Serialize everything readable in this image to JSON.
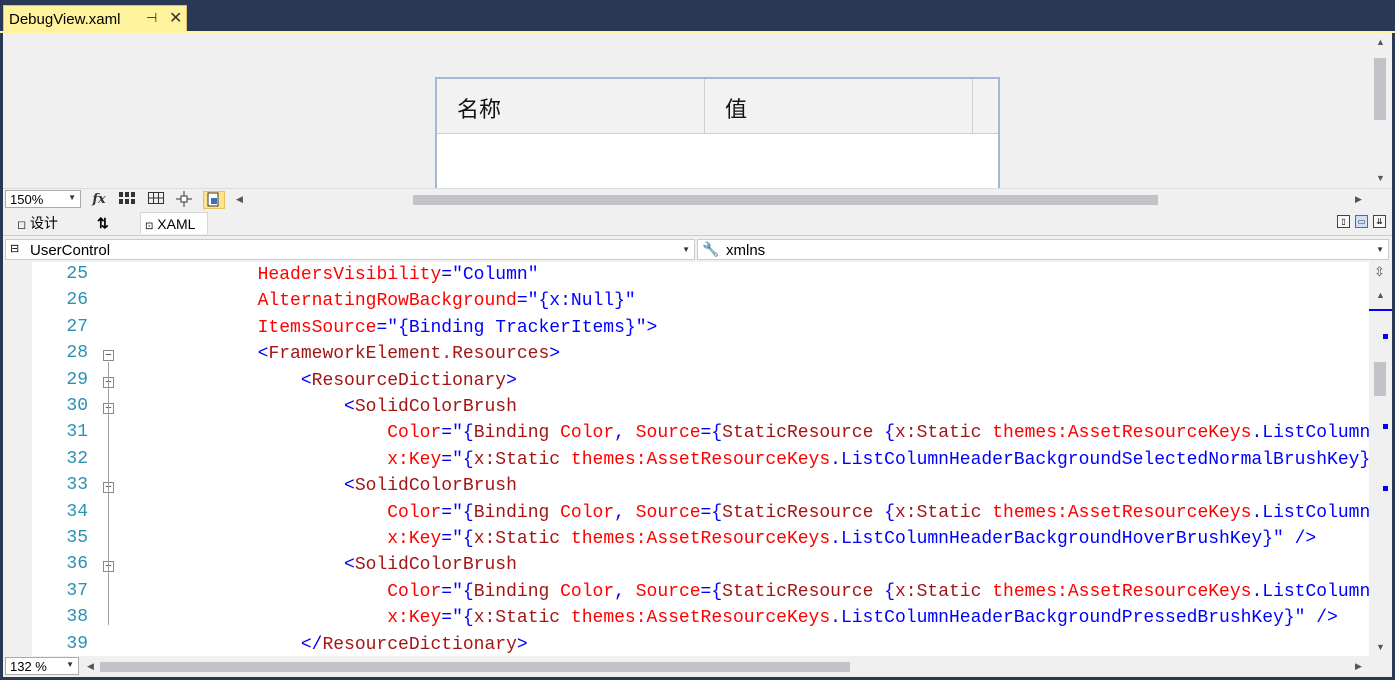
{
  "document_tab": {
    "title": "DebugView.xaml",
    "pin_glyph": "⊣",
    "close_glyph": "✕"
  },
  "designer": {
    "datagrid_columns": [
      "名称",
      "值"
    ],
    "zoom": "150%",
    "toolbar_icons": [
      "fx-icon",
      "grid-icon",
      "snap-grid-icon",
      "snap-lines-icon",
      "render-effects-icon"
    ]
  },
  "split_tabs": {
    "design_label": "设计",
    "swap_glyph": "⇅",
    "xaml_label": "XAML"
  },
  "navbar": {
    "left_value": "UserControl",
    "right_value": "xmlns"
  },
  "editor": {
    "zoom": "132 %",
    "lines": [
      {
        "n": "25",
        "fold": false,
        "segments": [
          {
            "c": "a",
            "t": "            HeadersVisibility"
          },
          {
            "c": "q",
            "t": "=\""
          },
          {
            "c": "s",
            "t": "Column"
          },
          {
            "c": "q",
            "t": "\""
          }
        ]
      },
      {
        "n": "26",
        "fold": false,
        "segments": [
          {
            "c": "a",
            "t": "            AlternatingRowBackground"
          },
          {
            "c": "q",
            "t": "=\""
          },
          {
            "c": "s",
            "t": "{x:Null}"
          },
          {
            "c": "q",
            "t": "\""
          }
        ]
      },
      {
        "n": "27",
        "fold": false,
        "segments": [
          {
            "c": "a",
            "t": "            ItemsSource"
          },
          {
            "c": "q",
            "t": "=\""
          },
          {
            "c": "s",
            "t": "{Binding TrackerItems}"
          },
          {
            "c": "q",
            "t": "\""
          },
          {
            "c": "q",
            "t": ">"
          }
        ]
      },
      {
        "n": "28",
        "fold": true,
        "segments": [
          {
            "c": "q",
            "t": "            <"
          },
          {
            "c": "t",
            "t": "FrameworkElement.Resources"
          },
          {
            "c": "q",
            "t": ">"
          }
        ]
      },
      {
        "n": "29",
        "fold": true,
        "segments": [
          {
            "c": "q",
            "t": "                <"
          },
          {
            "c": "t",
            "t": "ResourceDictionary"
          },
          {
            "c": "q",
            "t": ">"
          }
        ]
      },
      {
        "n": "30",
        "fold": true,
        "segments": [
          {
            "c": "q",
            "t": "                    <"
          },
          {
            "c": "t",
            "t": "SolidColorBrush"
          }
        ]
      },
      {
        "n": "31",
        "fold": false,
        "segments": [
          {
            "c": "a",
            "t": "                        Color"
          },
          {
            "c": "q",
            "t": "=\""
          },
          {
            "c": "s",
            "t": "{"
          },
          {
            "c": "t",
            "t": "Binding"
          },
          {
            "c": "a",
            "t": " Color"
          },
          {
            "c": "s",
            "t": ", "
          },
          {
            "c": "a",
            "t": "Source"
          },
          {
            "c": "s",
            "t": "={"
          },
          {
            "c": "t",
            "t": "StaticResource"
          },
          {
            "c": "s",
            "t": " {"
          },
          {
            "c": "t",
            "t": "x:Static"
          },
          {
            "c": "a",
            "t": " themes:AssetResourceKeys"
          },
          {
            "c": "s",
            "t": ".ListColumnHeaderBackgroundSelectedNormalBrushKey}}}"
          }
        ]
      },
      {
        "n": "32",
        "fold": false,
        "segments": [
          {
            "c": "a",
            "t": "                        x:Key"
          },
          {
            "c": "q",
            "t": "=\""
          },
          {
            "c": "s",
            "t": "{"
          },
          {
            "c": "t",
            "t": "x:Static"
          },
          {
            "c": "a",
            "t": " themes:AssetResourceKeys"
          },
          {
            "c": "s",
            "t": ".ListColumnHeaderBackgroundSelectedNormalBrushKey}"
          },
          {
            "c": "q",
            "t": "\" />"
          }
        ]
      },
      {
        "n": "33",
        "fold": true,
        "segments": [
          {
            "c": "q",
            "t": "                    <"
          },
          {
            "c": "t",
            "t": "SolidColorBrush"
          }
        ]
      },
      {
        "n": "34",
        "fold": false,
        "segments": [
          {
            "c": "a",
            "t": "                        Color"
          },
          {
            "c": "q",
            "t": "=\""
          },
          {
            "c": "s",
            "t": "{"
          },
          {
            "c": "t",
            "t": "Binding"
          },
          {
            "c": "a",
            "t": " Color"
          },
          {
            "c": "s",
            "t": ", "
          },
          {
            "c": "a",
            "t": "Source"
          },
          {
            "c": "s",
            "t": "={"
          },
          {
            "c": "t",
            "t": "StaticResource"
          },
          {
            "c": "s",
            "t": " {"
          },
          {
            "c": "t",
            "t": "x:Static"
          },
          {
            "c": "a",
            "t": " themes:AssetResourceKeys"
          },
          {
            "c": "s",
            "t": ".ListColumnHeaderBackgroundHoverBrushKey}}}"
          }
        ]
      },
      {
        "n": "35",
        "fold": false,
        "segments": [
          {
            "c": "a",
            "t": "                        x:Key"
          },
          {
            "c": "q",
            "t": "=\""
          },
          {
            "c": "s",
            "t": "{"
          },
          {
            "c": "t",
            "t": "x:Static"
          },
          {
            "c": "a",
            "t": " themes:AssetResourceKeys"
          },
          {
            "c": "s",
            "t": ".ListColumnHeaderBackgroundHoverBrushKey}"
          },
          {
            "c": "q",
            "t": "\" />"
          }
        ]
      },
      {
        "n": "36",
        "fold": true,
        "segments": [
          {
            "c": "q",
            "t": "                    <"
          },
          {
            "c": "t",
            "t": "SolidColorBrush"
          }
        ]
      },
      {
        "n": "37",
        "fold": false,
        "segments": [
          {
            "c": "a",
            "t": "                        Color"
          },
          {
            "c": "q",
            "t": "=\""
          },
          {
            "c": "s",
            "t": "{"
          },
          {
            "c": "t",
            "t": "Binding"
          },
          {
            "c": "a",
            "t": " Color"
          },
          {
            "c": "s",
            "t": ", "
          },
          {
            "c": "a",
            "t": "Source"
          },
          {
            "c": "s",
            "t": "={"
          },
          {
            "c": "t",
            "t": "StaticResource"
          },
          {
            "c": "s",
            "t": " {"
          },
          {
            "c": "t",
            "t": "x:Static"
          },
          {
            "c": "a",
            "t": " themes:AssetResourceKeys"
          },
          {
            "c": "s",
            "t": ".ListColumnHeaderBackgroundPressedBrushKey}}}"
          }
        ]
      },
      {
        "n": "38",
        "fold": false,
        "segments": [
          {
            "c": "a",
            "t": "                        x:Key"
          },
          {
            "c": "q",
            "t": "=\""
          },
          {
            "c": "s",
            "t": "{"
          },
          {
            "c": "t",
            "t": "x:Static"
          },
          {
            "c": "a",
            "t": " themes:AssetResourceKeys"
          },
          {
            "c": "s",
            "t": ".ListColumnHeaderBackgroundPressedBrushKey}"
          },
          {
            "c": "q",
            "t": "\" />"
          }
        ]
      },
      {
        "n": "39",
        "fold": false,
        "segments": [
          {
            "c": "q",
            "t": "                </"
          },
          {
            "c": "t",
            "t": "ResourceDictionary"
          },
          {
            "c": "q",
            "t": ">"
          }
        ]
      }
    ]
  },
  "colors": {
    "frame": "#293955",
    "active_tab": "#fff29d",
    "line_number": "#2b91af",
    "tag": "#a31515",
    "attribute": "#ff0000",
    "value": "#0000ff"
  }
}
